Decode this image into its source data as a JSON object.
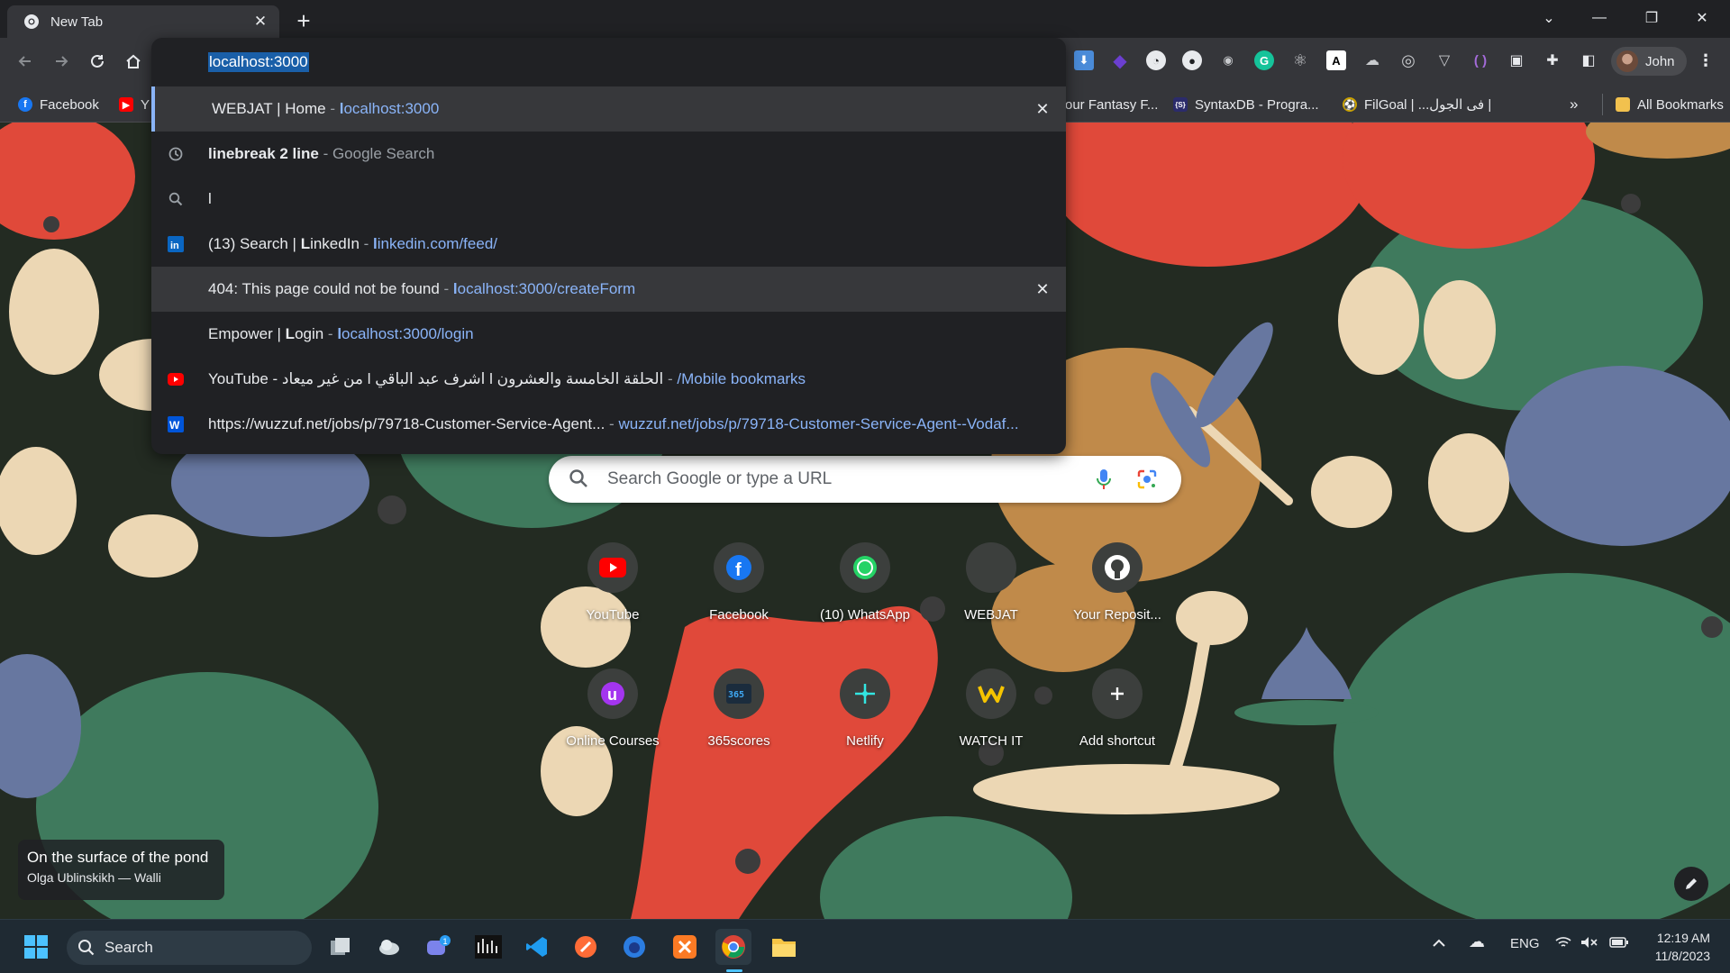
{
  "tab": {
    "title": "New Tab",
    "close_glyph": "✕",
    "new_tab_glyph": "+"
  },
  "window_controls": {
    "list": "⌄",
    "minimize": "—",
    "restore": "❐",
    "close": "✕"
  },
  "toolbar": {
    "profile_name": "John"
  },
  "bookmarks": {
    "items": [
      {
        "label": "Facebook",
        "icon": "facebook-icon",
        "color": "#1877f2"
      },
      {
        "label": "Y",
        "icon": "youtube-icon",
        "color": "#ff0000"
      },
      {
        "label": "our Fantasy F...",
        "icon": "fantasy-icon",
        "color": "#5f6368"
      },
      {
        "label": "SyntaxDB - Progra...",
        "icon": "syntaxdb-icon",
        "color": "#2b2b6b"
      },
      {
        "label": "FilGoal | ...فى الجول |",
        "icon": "filgoal-icon",
        "color": "#c8a000"
      }
    ],
    "overflow_glyph": "»",
    "all_bookmarks": "All Bookmarks"
  },
  "omnibox": {
    "input_value": "localhost:3000",
    "suggestions": [
      {
        "icon": "none",
        "title_plain": "WEBJAT | Home",
        "sep": " - ",
        "url_bold": "l",
        "url_rest": "ocalhost:3000",
        "removable": true,
        "highlighted": true
      },
      {
        "icon": "history-icon",
        "title_bold": "linebreak 2 line",
        "sep": " - ",
        "gray": "Google Search",
        "removable": false
      },
      {
        "icon": "search-icon",
        "title_plain": "l",
        "removable": false
      },
      {
        "icon": "linkedin-icon",
        "title_plain_a": "(13) Search | ",
        "title_bold_b": "L",
        "title_plain_c": "inkedIn",
        "sep": " - ",
        "url_bold": "l",
        "url_rest": "inkedin.com/feed/",
        "removable": false
      },
      {
        "icon": "none",
        "title_plain": "404: This page could not be found",
        "sep": " - ",
        "url_bold": "l",
        "url_rest": "ocalhost:3000/createForm",
        "removable": true,
        "highlighted": true
      },
      {
        "icon": "none",
        "title_plain_a": "Empower | ",
        "title_bold_b": "L",
        "title_plain_c": "ogin",
        "sep": " - ",
        "url_bold": "l",
        "url_rest": "ocalhost:3000/login",
        "removable": false
      },
      {
        "icon": "youtube-icon",
        "title_plain": "YouTube - من غير ميعاد l اشرف عبد الباقي l الحلقة الخامسة والعشرون",
        "sep": " - ",
        "url_rest": "/Mobile bookmarks",
        "removable": false
      },
      {
        "icon": "wuzzuf-icon",
        "title_plain": "https://wuzzuf.net/jobs/p/79718-Customer-Service-Agent...",
        "sep": " - ",
        "url_rest": "wuzzuf.net/jobs/p/79718-Customer-Service-Agent--Vodaf...",
        "removable": false
      }
    ],
    "remove_glyph": "✕"
  },
  "ntp": {
    "search_placeholder": "Search Google or type a URL",
    "shortcuts": [
      {
        "label": "YouTube",
        "icon": "youtube-icon"
      },
      {
        "label": "Facebook",
        "icon": "facebook-icon"
      },
      {
        "label": "(10) WhatsApp",
        "icon": "whatsapp-icon"
      },
      {
        "label": "WEBJAT",
        "icon": "webjat-icon"
      },
      {
        "label": "Your Reposit...",
        "icon": "github-icon"
      },
      {
        "label": "Online Courses",
        "icon": "udemy-icon"
      },
      {
        "label": "365scores",
        "icon": "365scores-icon"
      },
      {
        "label": "Netlify",
        "icon": "netlify-icon"
      },
      {
        "label": "WATCH IT",
        "icon": "watchit-icon"
      },
      {
        "label": "Add shortcut",
        "icon": "plus-icon"
      }
    ],
    "attribution_title": "On the surface of the pond",
    "attribution_author": "Olga Ublinskikh — Walli"
  },
  "taskbar": {
    "search_label": "Search",
    "chat_badge": "1",
    "language": "ENG",
    "time": "12:19 AM",
    "date": "11/8/2023"
  },
  "colors": {
    "accent": "#8ab4f8",
    "selection": "#1a5fa8",
    "dropdown_bg": "#202124",
    "toolbar_bg": "#35363a"
  }
}
